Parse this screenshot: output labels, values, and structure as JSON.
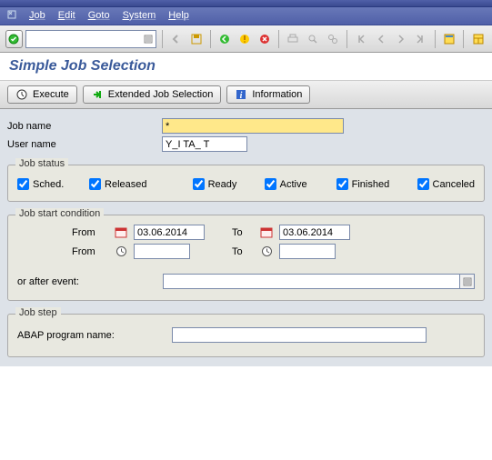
{
  "menu": {
    "job": "Job",
    "edit": "Edit",
    "goto": "Goto",
    "system": "System",
    "help": "Help"
  },
  "page": {
    "title": "Simple Job Selection"
  },
  "buttons": {
    "execute": "Execute",
    "extended": "Extended Job Selection",
    "info": "Information"
  },
  "fields": {
    "jobname_label": "Job name",
    "jobname_value": "*",
    "username_label": "User name",
    "username_value": "Y_I TA_ T"
  },
  "status_group": {
    "title": "Job status",
    "sched": "Sched.",
    "released": "Released",
    "ready": "Ready",
    "active": "Active",
    "finished": "Finished",
    "canceled": "Canceled"
  },
  "cond_group": {
    "title": "Job start condition",
    "from": "From",
    "to": "To",
    "date_from": "03.06.2014",
    "date_to": "03.06.2014",
    "time_from": "",
    "time_to": "",
    "or_after": "or after event:",
    "event_value": ""
  },
  "step_group": {
    "title": "Job step",
    "abap_label": "ABAP program name:",
    "abap_value": ""
  }
}
